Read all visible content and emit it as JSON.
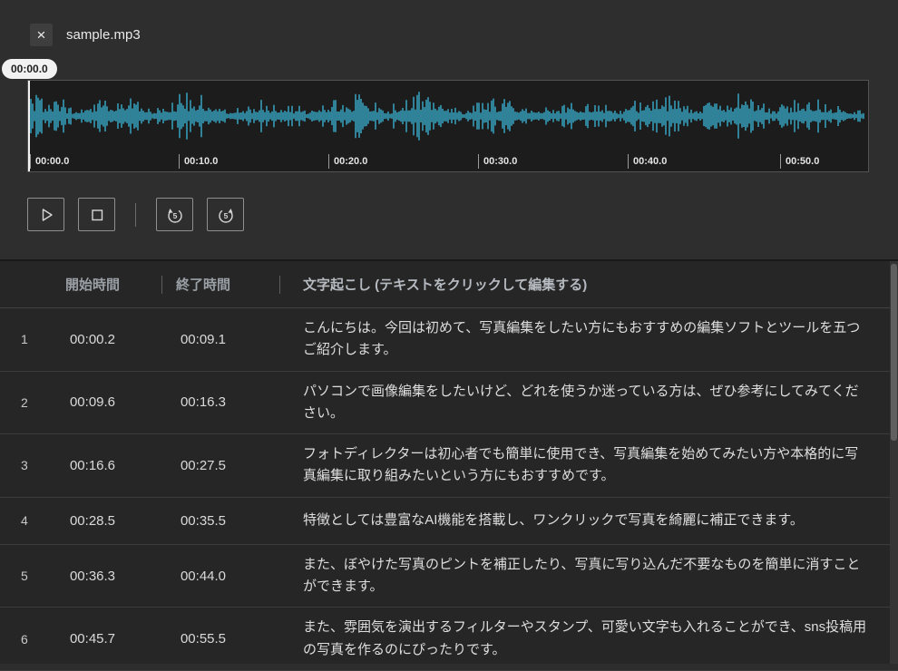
{
  "titlebar": {
    "close_glyph": "×",
    "filename": "sample.mp3"
  },
  "player": {
    "current_time": "00:00.0",
    "skip_seconds": "5",
    "ruler": [
      "00:00.0",
      "00:10.0",
      "00:20.0",
      "00:30.0",
      "00:40.0",
      "00:50.0"
    ]
  },
  "table": {
    "headers": {
      "start": "開始時間",
      "end": "終了時間",
      "text": "文字起こし (テキストをクリックして編集する)"
    },
    "rows": [
      {
        "index": "1",
        "start": "00:00.2",
        "end": "00:09.1",
        "text": "こんにちは。今回は初めて、写真編集をしたい方にもおすすめの編集ソフトとツールを五つご紹介します。"
      },
      {
        "index": "2",
        "start": "00:09.6",
        "end": "00:16.3",
        "text": "パソコンで画像編集をしたいけど、どれを使うか迷っている方は、ぜひ参考にしてみてください。"
      },
      {
        "index": "3",
        "start": "00:16.6",
        "end": "00:27.5",
        "text": "フォトディレクターは初心者でも簡単に使用でき、写真編集を始めてみたい方や本格的に写真編集に取り組みたいという方にもおすすめです。"
      },
      {
        "index": "4",
        "start": "00:28.5",
        "end": "00:35.5",
        "text": "特徴としては豊富なAI機能を搭載し、ワンクリックで写真を綺麗に補正できます。"
      },
      {
        "index": "5",
        "start": "00:36.3",
        "end": "00:44.0",
        "text": "また、ぼやけた写真のピントを補正したり、写真に写り込んだ不要なものを簡単に消すことができます。"
      },
      {
        "index": "6",
        "start": "00:45.7",
        "end": "00:55.5",
        "text": "また、雰囲気を演出するフィルターやスタンプ、可愛い文字も入れることができ、sns投稿用の写真を作るのにぴったりです。"
      }
    ]
  },
  "colors": {
    "waveform": "#3cb9dc",
    "playhead": "#f2f2f2"
  }
}
